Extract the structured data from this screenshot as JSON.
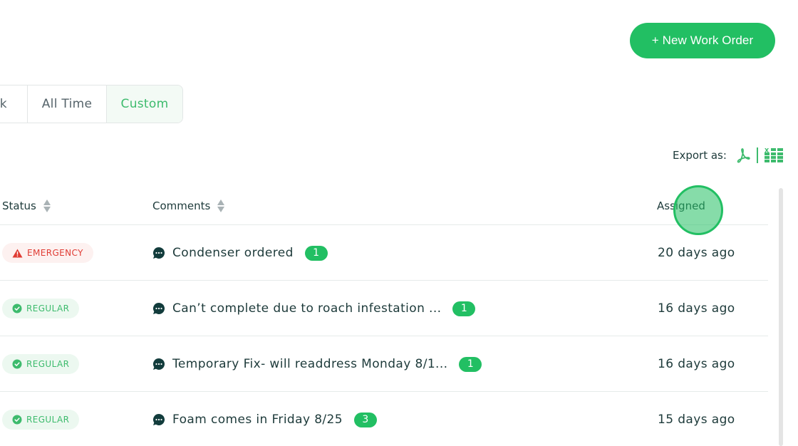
{
  "header": {
    "new_work_order_label": "+ New Work Order"
  },
  "date_filter": {
    "options": [
      {
        "label": "Week",
        "visible_text": "ek",
        "selected": false
      },
      {
        "label": "All Time",
        "visible_text": "All Time",
        "selected": false
      },
      {
        "label": "Custom",
        "visible_text": "Custom",
        "selected": true
      }
    ]
  },
  "export": {
    "label": "Export as:",
    "formats": [
      {
        "icon": "pdf-icon",
        "name": "PDF"
      },
      {
        "icon": "excel-icon",
        "name": "Excel"
      }
    ]
  },
  "table": {
    "columns": [
      {
        "key": "status",
        "label": "Status",
        "sortable": true
      },
      {
        "key": "comments",
        "label": "Comments",
        "sortable": true
      },
      {
        "key": "assigned",
        "label": "Assigned",
        "sortable": true
      }
    ],
    "rows": [
      {
        "status": "EMERGENCY",
        "status_type": "emergency",
        "comment": "Condenser ordered",
        "comment_count": "1",
        "assigned": "20 days ago"
      },
      {
        "status": "REGULAR",
        "status_type": "regular",
        "comment": "Can’t complete due to roach infestation ...",
        "comment_count": "1",
        "assigned": "16 days ago"
      },
      {
        "status": "REGULAR",
        "status_type": "regular",
        "comment": "Temporary Fix- will readdress Monday 8/1...",
        "comment_count": "1",
        "assigned": "16 days ago"
      },
      {
        "status": "REGULAR",
        "status_type": "regular",
        "comment": "Foam comes in Friday 8/25",
        "comment_count": "3",
        "assigned": "15 days ago"
      }
    ]
  },
  "colors": {
    "brand_green": "#22bf63",
    "emergency_red": "#e03c34",
    "text_dark": "#1d3a3a"
  }
}
